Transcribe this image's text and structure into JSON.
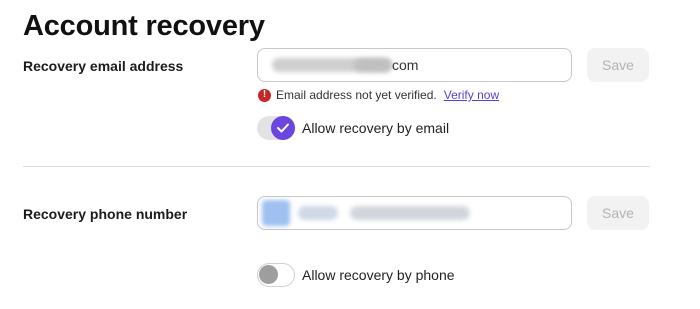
{
  "page": {
    "title": "Account recovery"
  },
  "email": {
    "label": "Recovery email address",
    "value_suffix": "com",
    "save_label": "Save",
    "warning_text": "Email address not yet verified.",
    "verify_link": "Verify now",
    "toggle_label": "Allow recovery by email",
    "toggle_on": true
  },
  "phone": {
    "label": "Recovery phone number",
    "save_label": "Save",
    "toggle_label": "Allow recovery by phone",
    "toggle_on": false
  },
  "colors": {
    "accent": "#6a45e0",
    "error": "#c62828",
    "link": "#5a3fd8"
  },
  "icons": {
    "warning": "error-circle-icon",
    "checkmark": "checkmark-icon"
  }
}
